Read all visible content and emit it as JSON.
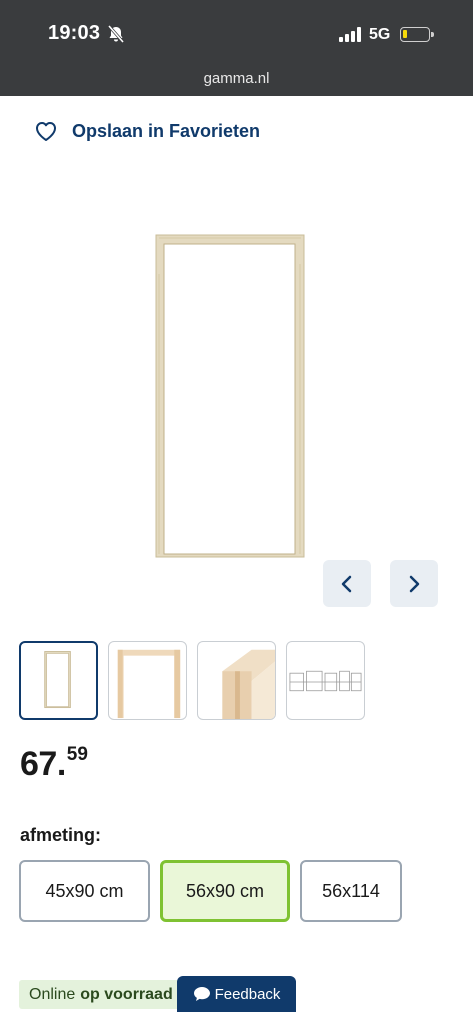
{
  "status_bar": {
    "time": "19:03",
    "network": "5G",
    "bell_icon": "bell-slash-icon",
    "signal_icon": "cellular-signal-icon",
    "battery_icon": "battery-low-icon"
  },
  "browser": {
    "url": "gamma.nl"
  },
  "favorite": {
    "label": "Opslaan in Favorieten",
    "icon": "heart-outline-icon"
  },
  "gallery": {
    "prev_icon": "chevron-left-icon",
    "next_icon": "chevron-right-icon",
    "thumbnail_count": 4,
    "active_index": 0
  },
  "price": {
    "integer": "67.",
    "decimal": "59"
  },
  "size": {
    "label": "afmeting:",
    "options": [
      "45x90 cm",
      "56x90 cm",
      "56x114"
    ],
    "selected": "56x90 cm"
  },
  "stock": {
    "prefix": "Online",
    "status": "op voorraad"
  },
  "feedback": {
    "label": "Feedback",
    "icon": "chat-bubble-icon"
  },
  "colors": {
    "brand_blue": "#103a6b",
    "selected_green": "#7fc232",
    "stock_bg": "#e4f2dc"
  }
}
